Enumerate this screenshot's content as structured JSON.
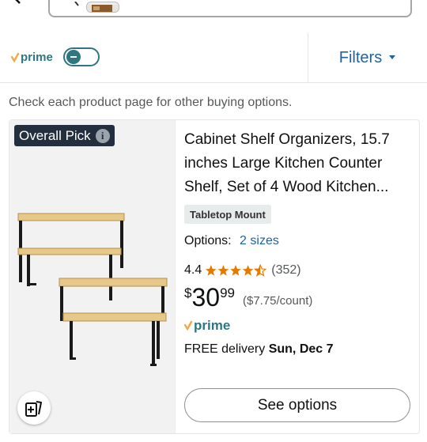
{
  "filter_bar": {
    "prime_logo_text": "prime",
    "prime_toggle_state": "off",
    "filters_label": "Filters"
  },
  "notice": "Check each product page for other buying options.",
  "product": {
    "badge": "Overall Pick",
    "title": "Cabinet Shelf Organizers, 15.7 inches Large Kitchen Counter Shelf, Set of 4 Wood Kitchen...",
    "tag": "Tabletop Mount",
    "options_label": "Options:",
    "options_value": "2 sizes",
    "rating": "4.4",
    "rating_stars": 4.4,
    "review_count": "(352)",
    "price_currency": "$",
    "price_whole": "30",
    "price_fraction": "99",
    "unit_price": "($7.75/count)",
    "prime_text": "prime",
    "delivery_prefix": "FREE delivery",
    "delivery_date": "Sun, Dec 7",
    "cta": "See options"
  },
  "colors": {
    "link": "#2162a1",
    "prime_teal": "#2e7680",
    "prime_orange": "#f3a847",
    "star": "#e67a00",
    "badge_bg": "#232f3e"
  },
  "icons": [
    "chevron-left-icon",
    "search-icon",
    "info-icon",
    "compare-icon",
    "chevron-down-icon"
  ]
}
